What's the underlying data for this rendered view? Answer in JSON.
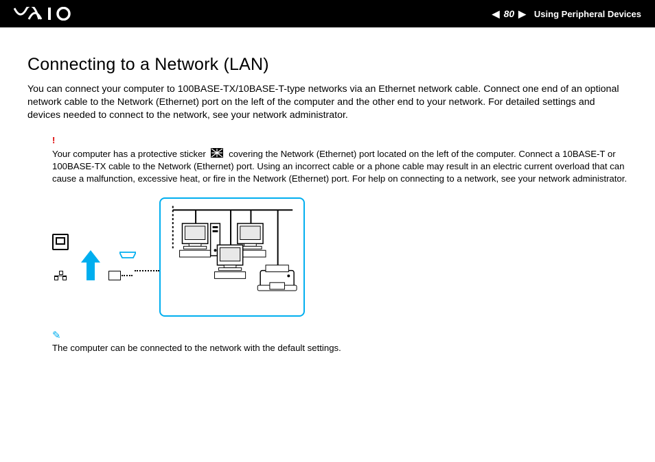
{
  "header": {
    "logo_alt": "VAIO",
    "page_number": "80",
    "section_label": "Using Peripheral Devices"
  },
  "title": "Connecting to a Network (LAN)",
  "intro_text": "You can connect your computer to 100BASE-TX/10BASE-T-type networks via an Ethernet network cable. Connect one end of an optional network cable to the Network (Ethernet) port on the left of the computer and the other end to your network. For detailed settings and devices needed to connect to the network, see your network administrator.",
  "warning": {
    "symbol": "!",
    "text_before_icon": "Your computer has a protective sticker ",
    "text_after_icon": " covering the Network (Ethernet) port located on the left of the computer. Connect a 10BASE-T or 100BASE-TX cable to the Network (Ethernet) port. Using an incorrect cable or a phone cable may result in an electric current overload that can cause a malfunction, excessive heat, or fire in the Network (Ethernet) port. For help on connecting to a network, see your network administrator."
  },
  "note": {
    "symbol": "✎",
    "text": "The computer can be connected to the network with the default settings."
  }
}
